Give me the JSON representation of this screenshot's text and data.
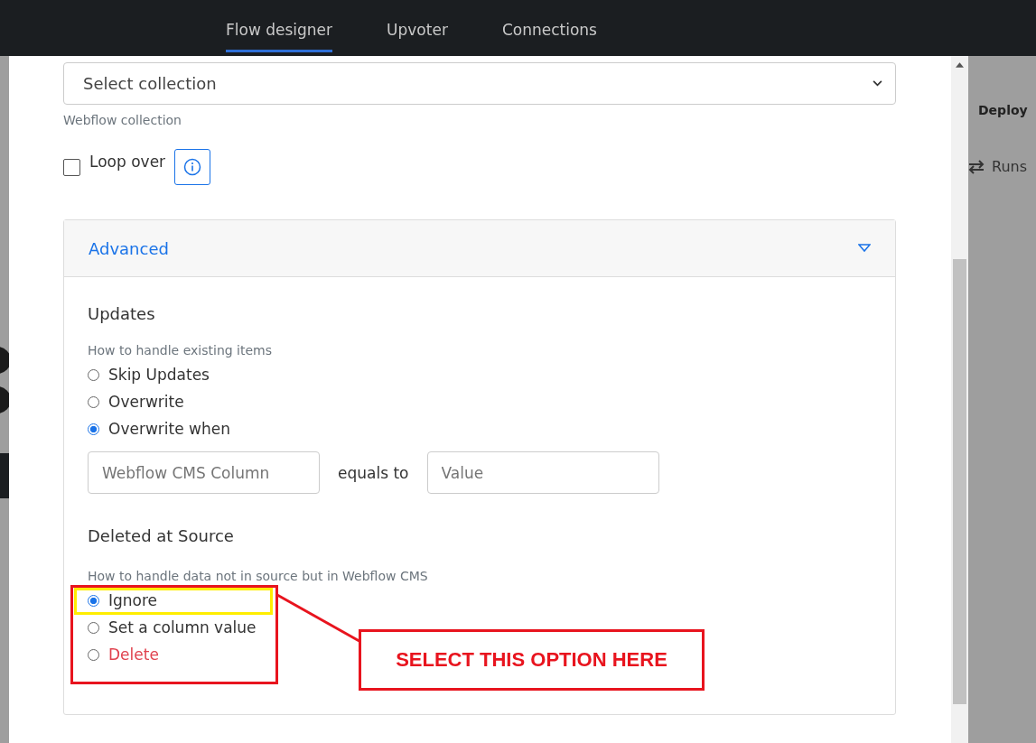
{
  "nav": {
    "tabs": [
      {
        "label": "Flow designer",
        "selected": true
      },
      {
        "label": "Upvoter",
        "selected": false
      },
      {
        "label": "Connections",
        "selected": false
      }
    ]
  },
  "background": {
    "deploy": "Deploy",
    "runs": "Runs"
  },
  "modal": {
    "collection_select": {
      "placeholder": "Select collection",
      "hint": "Webflow collection"
    },
    "loop_over": {
      "label": "Loop over",
      "checked": false
    },
    "advanced": {
      "title": "Advanced",
      "expanded": true,
      "updates": {
        "title": "Updates",
        "hint": "How to handle existing items",
        "options": [
          {
            "label": "Skip Updates",
            "selected": false
          },
          {
            "label": "Overwrite",
            "selected": false
          },
          {
            "label": "Overwrite when",
            "selected": true
          }
        ],
        "column_field": {
          "placeholder": "Webflow CMS Column"
        },
        "connector": "equals to",
        "value_field": {
          "placeholder": "Value"
        }
      },
      "deleted": {
        "title": "Deleted at Source",
        "hint": "How to handle data not in source but in Webflow CMS",
        "options": [
          {
            "label": "Ignore",
            "selected": true,
            "kind": "normal"
          },
          {
            "label": "Set a column value",
            "selected": false,
            "kind": "normal"
          },
          {
            "label": "Delete",
            "selected": false,
            "kind": "danger"
          }
        ]
      }
    }
  },
  "annotation": {
    "callout": "SELECT THIS OPTION HERE"
  }
}
